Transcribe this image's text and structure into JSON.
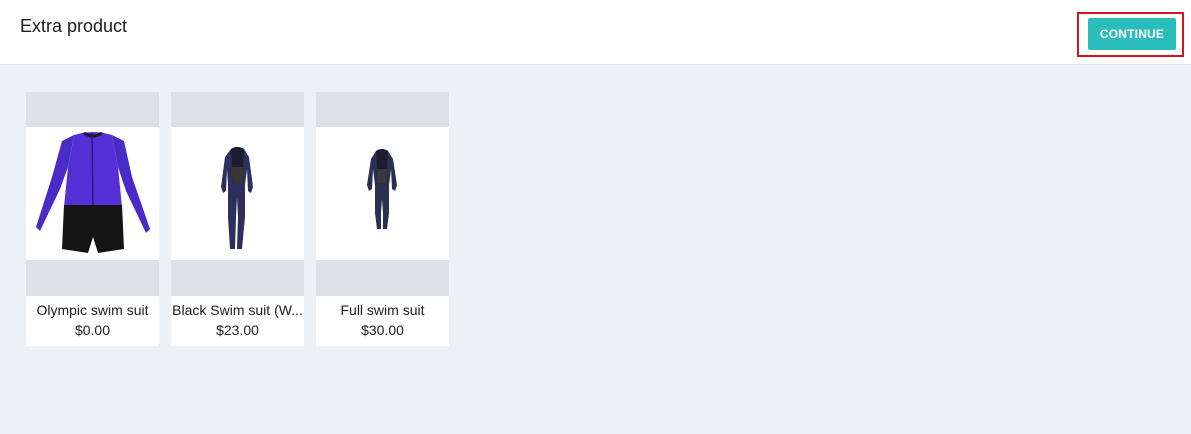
{
  "header": {
    "title": "Extra product",
    "continue_label": "CONTINUE"
  },
  "products": [
    {
      "name": "Olympic swim suit",
      "price": "$0.00",
      "icon": "swimsuit-icon"
    },
    {
      "name": "Black Swim suit (W...",
      "price": "$23.00",
      "icon": "wetsuit-icon"
    },
    {
      "name": "Full swim suit",
      "price": "$30.00",
      "icon": "wetsuit-icon"
    }
  ],
  "colors": {
    "accent": "#2bbcbc",
    "highlight_border": "#d6141b",
    "page_bg": "#edf0f4"
  }
}
